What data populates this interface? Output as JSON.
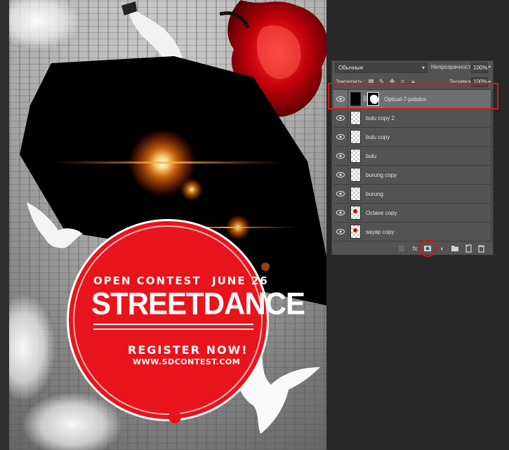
{
  "poster": {
    "open_contest": "OPEN CONTEST",
    "date": "JUNE 26",
    "headline": "STREETDANCE",
    "register": "REGISTER NOW!",
    "url": "WWW.SDCONTEST.COM"
  },
  "layers_panel": {
    "blend_mode": "Обычные",
    "opacity_label": "Непрозрачность:",
    "opacity_value": "100%",
    "lock_label": "Закрепить:",
    "fill_label": "Заливка:",
    "fill_value": "100%",
    "layers": [
      {
        "name": "Optical-7-psbdox",
        "selected": true,
        "visible": true
      },
      {
        "name": "bulu copy 2",
        "selected": false,
        "visible": true
      },
      {
        "name": "bulu copy",
        "selected": false,
        "visible": true
      },
      {
        "name": "bulu",
        "selected": false,
        "visible": true
      },
      {
        "name": "burung copy",
        "selected": false,
        "visible": true
      },
      {
        "name": "burung",
        "selected": false,
        "visible": true
      },
      {
        "name": "Octave copy",
        "selected": false,
        "visible": true
      },
      {
        "name": "sayap copy",
        "selected": false,
        "visible": true
      }
    ],
    "bottom_icons": [
      "link-layers-icon",
      "fx-icon",
      "add-mask-icon",
      "adjustment-layer-icon",
      "folder-icon",
      "new-layer-icon",
      "trash-icon"
    ]
  },
  "colors": {
    "poster_red": "#e8141c",
    "highlight_red": "#d4161d",
    "panel_bg": "#535353",
    "app_bg": "#282828"
  }
}
